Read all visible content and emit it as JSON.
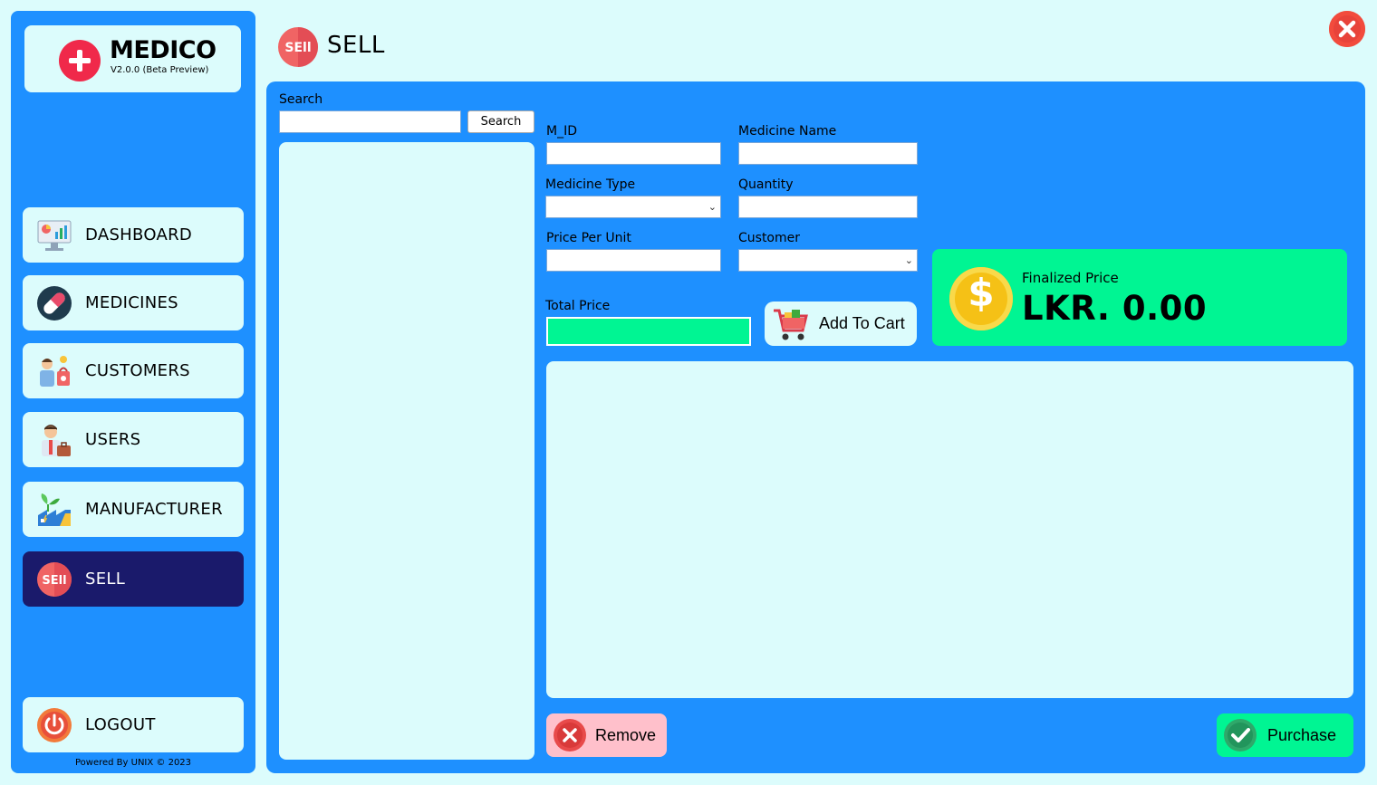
{
  "brand": {
    "name": "MEDICO",
    "version": "V2.0.0 (Beta Preview)"
  },
  "sidebar": {
    "items": [
      {
        "label": "DASHBOARD",
        "icon": "dashboard-icon"
      },
      {
        "label": "MEDICINES",
        "icon": "pill-icon"
      },
      {
        "label": "CUSTOMERS",
        "icon": "customers-icon"
      },
      {
        "label": "USERS",
        "icon": "user-icon"
      },
      {
        "label": "MANUFACTURER",
        "icon": "factory-icon"
      },
      {
        "label": "SELL",
        "icon": "sell-icon",
        "active": true
      }
    ],
    "logout": "LOGOUT",
    "footer": "Powered By UNIX © 2023"
  },
  "header": {
    "title": "SELL",
    "icon_text": "SEll"
  },
  "search": {
    "label": "Search",
    "value": "",
    "button": "Search"
  },
  "form": {
    "m_id": {
      "label": "M_ID",
      "value": ""
    },
    "medicine_name": {
      "label": "Medicine Name",
      "value": ""
    },
    "medicine_type": {
      "label": "Medicine Type",
      "value": ""
    },
    "quantity": {
      "label": "Quantity",
      "value": ""
    },
    "price_per_unit": {
      "label": "Price Per Unit",
      "value": ""
    },
    "customer": {
      "label": "Customer",
      "value": ""
    },
    "total_price": {
      "label": "Total Price",
      "value": ""
    }
  },
  "actions": {
    "add_to_cart": "Add To Cart",
    "remove": "Remove",
    "purchase": "Purchase"
  },
  "finalized": {
    "label": "Finalized Price",
    "value": "LKR. 0.00",
    "currency_symbol": "$"
  },
  "colors": {
    "background": "#dcfcfc",
    "panel": "#1e90ff",
    "active_nav": "#1a1a6b",
    "accent_green": "#00f593",
    "remove_pink": "#ffc0cb",
    "close_red": "#f24b3d"
  }
}
